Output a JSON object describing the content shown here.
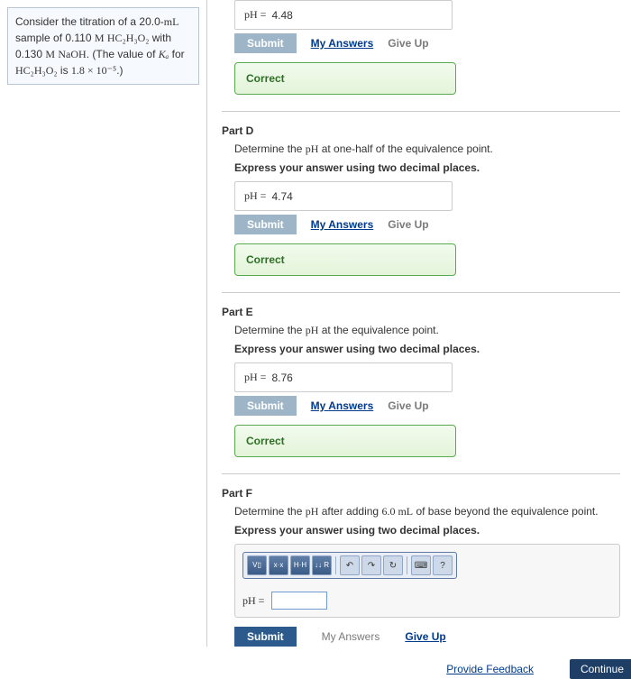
{
  "problem": {
    "text_prefix": "Consider the titration of a 20.0-",
    "vol_unit": "mL",
    "text_mid1": " sample of 0.110 ",
    "conc_unit": "M",
    "acid": "HC₂H₃O₂",
    "text_mid2": " with 0.130 ",
    "base_conc_unit": "M",
    "base": "NaOH",
    "text_mid3": ". (The value of ",
    "ka": "Kₐ",
    "text_mid4": " for ",
    "acid2": "HC₂H₃O₂",
    "text_mid5": " is ",
    "ka_val": "1.8 × 10⁻⁵",
    "text_end": ".)"
  },
  "labels": {
    "ph_equals": "pH =",
    "submit": "Submit",
    "my_answers": "My Answers",
    "give_up": "Give Up",
    "correct": "Correct",
    "provide_feedback": "Provide Feedback",
    "continue": "Continue"
  },
  "partC": {
    "value": "4.48"
  },
  "partD": {
    "title": "Part D",
    "prompt_prefix": "Determine the ",
    "prompt_var": "pH",
    "prompt_suffix": " at one-half of the equivalence point.",
    "instr": "Express your answer using two decimal places.",
    "value": "4.74"
  },
  "partE": {
    "title": "Part E",
    "prompt_prefix": "Determine the ",
    "prompt_var": "pH",
    "prompt_suffix": " at the equivalence point.",
    "instr": "Express your answer using two decimal places.",
    "value": "8.76"
  },
  "partF": {
    "title": "Part F",
    "prompt_prefix": "Determine the ",
    "prompt_var": "pH",
    "prompt_mid": " after adding ",
    "amount": "6.0 ",
    "unit": "mL",
    "prompt_suffix": " of base beyond the equivalence point.",
    "instr": "Express your answer using two decimal places.",
    "toolbar": {
      "help": "?"
    }
  }
}
